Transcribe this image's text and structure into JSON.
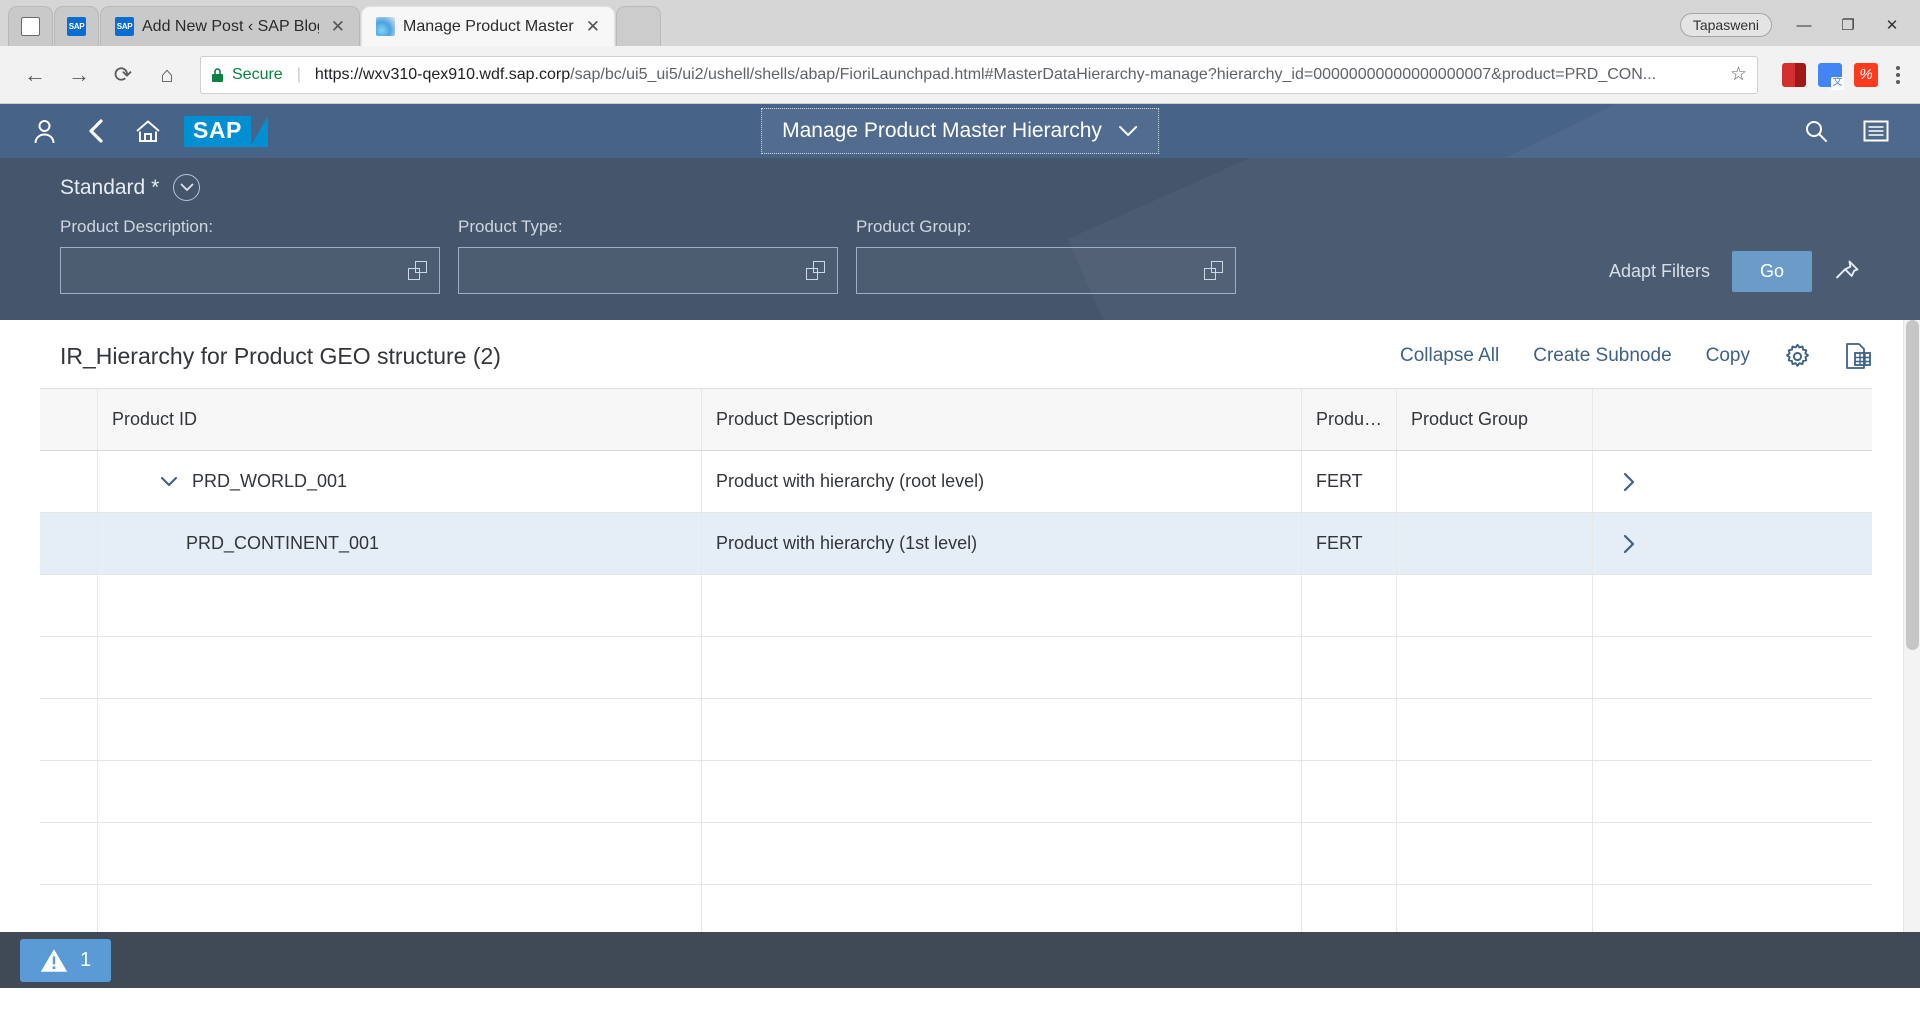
{
  "browser": {
    "tabs": [
      {
        "title": "",
        "icon": "page-icon",
        "active": false,
        "closable": false
      },
      {
        "title": "",
        "icon": "sap-icon",
        "active": false,
        "closable": false
      },
      {
        "title": "Add New Post ‹ SAP Blog",
        "icon": "sap-icon",
        "active": false,
        "closable": true
      },
      {
        "title": "Manage Product Master",
        "icon": "fiori-icon",
        "active": true,
        "closable": true
      }
    ],
    "close_glyph": "✕",
    "profile_name": "Tapasweni",
    "window_controls": {
      "minimize": "—",
      "maximize": "❐",
      "close": "✕"
    },
    "nav": {
      "back": "←",
      "forward": "→",
      "reload": "⟳",
      "home": "⌂"
    },
    "security_label": "Secure",
    "url_scheme": "https://",
    "url_host": "wxv310-qex910.wdf.sap.corp",
    "url_path": "/sap/bc/ui5_ui5/ui2/ushell/shells/abap/FioriLaunchpad.html#MasterDataHierarchy-manage?hierarchy_id=00000000000000000007&product=PRD_CON...",
    "bookmark_glyph": "☆",
    "extensions": [
      "adobe-extension-icon",
      "google-translate-icon",
      "red-extension-icon"
    ],
    "menu_glyph": "⋮"
  },
  "shell": {
    "icons": [
      "user-icon",
      "back-icon",
      "home-icon"
    ],
    "logo_text": "SAP",
    "title": "Manage Product Master Hierarchy",
    "title_chevron": "⌄",
    "right_icons": [
      "search-icon",
      "menu-icon"
    ]
  },
  "filterbar": {
    "variant_label": "Standard *",
    "variant_chevron": "⌄",
    "fields": [
      {
        "label": "Product Description:",
        "value": "",
        "placeholder": ""
      },
      {
        "label": "Product Type:",
        "value": "",
        "placeholder": ""
      },
      {
        "label": "Product Group:",
        "value": "",
        "placeholder": ""
      }
    ],
    "adapt_filters_label": "Adapt Filters",
    "go_label": "Go",
    "pin_icon": "pin-icon",
    "accent_go": "#6a9bc9"
  },
  "table": {
    "title": "IR_Hierarchy for Product GEO structure (2)",
    "count": 2,
    "actions": [
      {
        "label": "Collapse All",
        "name": "collapse-all-button"
      },
      {
        "label": "Create Subnode",
        "name": "create-subnode-button"
      },
      {
        "label": "Copy",
        "name": "copy-button"
      }
    ],
    "icon_actions": [
      "gear-icon",
      "spreadsheet-export-icon"
    ],
    "columns": [
      {
        "label": "Product ID"
      },
      {
        "label": "Product Description"
      },
      {
        "label": "Produ…"
      },
      {
        "label": "Product Group"
      }
    ],
    "rows": [
      {
        "product_id": "PRD_WORLD_001",
        "description": "Product with hierarchy (root level)",
        "product_type": "FERT",
        "product_group": "",
        "level": 0,
        "expanded": true,
        "selected": false
      },
      {
        "product_id": "PRD_CONTINENT_001",
        "description": "Product with hierarchy (1st level)",
        "product_type": "FERT",
        "product_group": "",
        "level": 1,
        "expanded": false,
        "selected": true
      }
    ],
    "empty_row_count": 6,
    "selected_row_color": "#e5edf7"
  },
  "footer": {
    "message_count": "1",
    "message_icon": "warning-triangle-icon",
    "badge_color": "#5a9bd5"
  }
}
